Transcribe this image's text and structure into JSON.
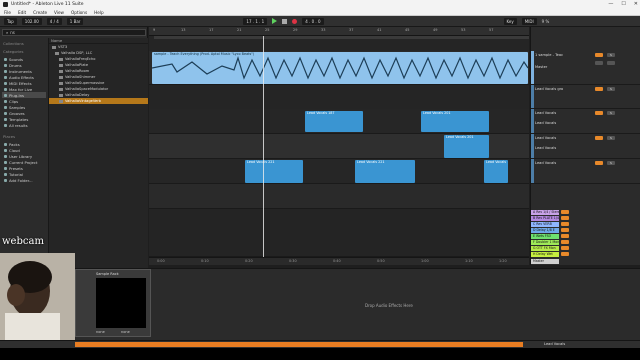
{
  "window": {
    "title": "Untitled* - Ableton Live 11 Suite",
    "buttons": [
      "—",
      "☐",
      "✕"
    ]
  },
  "menu": [
    "File",
    "Edit",
    "Create",
    "View",
    "Options",
    "Help"
  ],
  "transport": {
    "tap": "Tap",
    "tempo": "102.00",
    "sig": "4 / 4",
    "bar": "1 Bar",
    "position": "17 . 1 . 1",
    "end": "4 . 0 . 0",
    "key": "Key",
    "midi": "MIDI",
    "cpu": "9 %"
  },
  "browser": {
    "search": "ns",
    "collections_title": "Collections",
    "categories_title": "Categories",
    "categories": [
      "Sounds",
      "Drums",
      "Instruments",
      "Audio Effects",
      "MIDI Effects",
      "Max for Live",
      "Plug-Ins",
      "Clips",
      "Samples",
      "Grooves",
      "Templates",
      "All results"
    ],
    "places_title": "Places",
    "places": [
      "Packs",
      "Cloud",
      "User Library",
      "Current Project",
      "Presets",
      "Tutorial",
      "Add Folder..."
    ],
    "file_header": "Name",
    "files": [
      "VST3",
      "Valhalla DSP, LLC",
      "ValhallaFreqEcho",
      "ValhallaPlate",
      "ValhallaRoom",
      "ValhallaShimmer",
      "ValhallaSupermassive",
      "ValhallaSpaceModulator",
      "ValhallaDelay",
      "ValhallaVintageVerb"
    ],
    "selected_file": "ValhallaVintageVerb"
  },
  "ruler_marks": [
    "9",
    "13",
    "17",
    "21",
    "25",
    "29",
    "33",
    "37",
    "41",
    "45",
    "49",
    "53",
    "57"
  ],
  "time_marks": [
    "0:00",
    "0:10",
    "0:20",
    "0:30",
    "0:40",
    "0:50",
    "1:00",
    "1:10",
    "1:20"
  ],
  "clips": [
    {
      "label": "sample - Teach Everything (Prod. Aptol Music \"Lyco Beats\")",
      "lane": 0
    },
    {
      "label": "Lead Vocals 187",
      "lane": 1
    },
    {
      "label": "Lead Vocals 201",
      "lane": 1
    },
    {
      "label": "Lead Vocals 201",
      "lane": 2
    },
    {
      "label": "Lead Vocals 221",
      "lane": 3
    },
    {
      "label": "Lead Vocals 221",
      "lane": 3
    },
    {
      "label": "Lead Vocals",
      "lane": 3
    }
  ],
  "mixer": {
    "tracks": [
      {
        "name": "1 sample - Teac",
        "color": "#7fb3e0"
      },
      {
        "name": "Lead Vocals gro",
        "color": "#4d7ea8"
      },
      {
        "name": "Lead Vocals",
        "color": "#4d7ea8"
      },
      {
        "name": "Lead Vocals",
        "color": "#4d7ea8"
      },
      {
        "name": "Lead Vocals",
        "color": "#4d7ea8"
      }
    ],
    "sub_labels": [
      "Master",
      "Lead Vocals",
      "Lead Vocals"
    ],
    "returns": [
      {
        "name": "A Rev 1/4 / Stere",
        "color": "#c8a2e8"
      },
      {
        "name": "B Rev PLATE 1/4",
        "color": "#b388e0"
      },
      {
        "name": "C Rev VERB",
        "color": "#8fb6ff"
      },
      {
        "name": "D Delay 1/8 E",
        "color": "#6fa8e8"
      },
      {
        "name": "E Wets FSO",
        "color": "#6ee06e"
      },
      {
        "name": "F Doubler 1 Mon",
        "color": "#9eea58"
      },
      {
        "name": "G OTT FX Mon",
        "color": "#b5ea4a"
      },
      {
        "name": "H Delay Wet",
        "color": "#c6ee40"
      }
    ],
    "master": "Master"
  },
  "device": {
    "drop_text": "Drop Audio Effects Here",
    "none1": "none",
    "none2": "none",
    "instrument": "Sample Rack"
  },
  "status": {
    "right": "Lead Vocals"
  },
  "webcam": {
    "label": "webcam"
  }
}
